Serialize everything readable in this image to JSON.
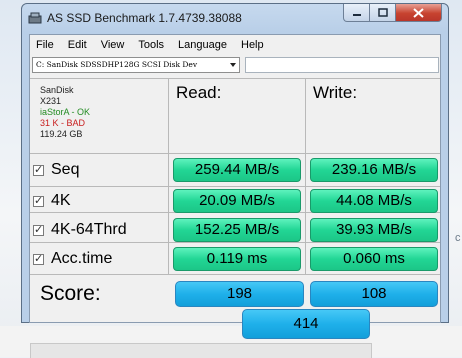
{
  "window": {
    "title": "AS SSD Benchmark 1.7.4739.38088"
  },
  "menu": [
    "File",
    "Edit",
    "View",
    "Tools",
    "Language",
    "Help"
  ],
  "drive_select": {
    "value": "C: SanDisk SDSSDHP128G SCSI Disk Dev"
  },
  "drive_info": {
    "vendor": "SanDisk",
    "model": "X231",
    "driver": "iaStorA - OK",
    "alignment": "31 K - BAD",
    "capacity": "119.24 GB"
  },
  "columns": {
    "read": "Read:",
    "write": "Write:"
  },
  "rows": [
    {
      "label": "Seq",
      "checked": true,
      "read": "259.44 MB/s",
      "write": "239.16 MB/s"
    },
    {
      "label": "4K",
      "checked": true,
      "read": "20.09 MB/s",
      "write": "44.08 MB/s"
    },
    {
      "label": "4K-64Thrd",
      "checked": true,
      "read": "152.25 MB/s",
      "write": "39.93 MB/s"
    },
    {
      "label": "Acc.time",
      "checked": true,
      "read": "0.119 ms",
      "write": "0.060 ms"
    }
  ],
  "score": {
    "label": "Score:",
    "read": "198",
    "write": "108",
    "total": "414"
  },
  "colors": {
    "result_green": "#22d695",
    "score_blue": "#1fb0ea",
    "ok_green": "#238c23",
    "bad_red": "#c81e1e"
  }
}
